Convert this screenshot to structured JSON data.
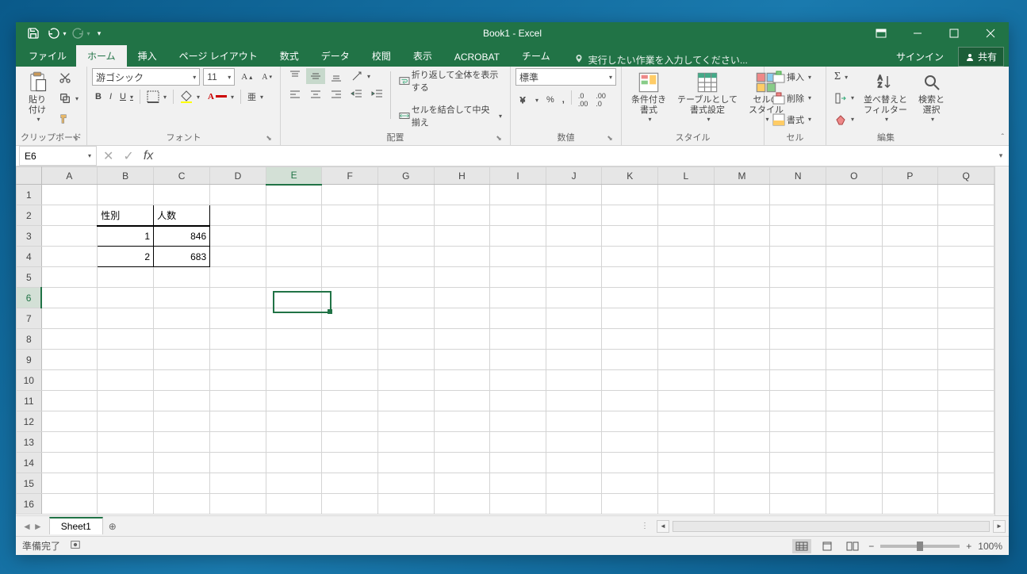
{
  "app": {
    "title": "Book1 - Excel"
  },
  "qat": {
    "save": "保存",
    "undo": "元に戻す",
    "redo": "やり直し"
  },
  "window_controls": {
    "ribbon_display": "リボンの表示オプション",
    "minimize": "最小化",
    "maximize": "最大化",
    "close": "閉じる"
  },
  "tabs": {
    "file": "ファイル",
    "items": [
      "ホーム",
      "挿入",
      "ページ レイアウト",
      "数式",
      "データ",
      "校閲",
      "表示",
      "ACROBAT",
      "チーム"
    ],
    "active_index": 0,
    "tell_me": "実行したい作業を入力してください...",
    "signin": "サインイン",
    "share": "共有"
  },
  "ribbon": {
    "clipboard": {
      "label": "クリップボード",
      "paste": "貼り付け"
    },
    "font": {
      "label": "フォント",
      "name": "游ゴシック",
      "size": "11",
      "bold": "B",
      "italic": "I",
      "underline": "U"
    },
    "alignment": {
      "label": "配置",
      "wrap": "折り返して全体を表示する",
      "merge": "セルを結合して中央揃え"
    },
    "number": {
      "label": "数値",
      "format": "標準"
    },
    "styles": {
      "label": "スタイル",
      "conditional": "条件付き\n書式",
      "table": "テーブルとして\n書式設定",
      "cell": "セルの\nスタイル"
    },
    "cells": {
      "label": "セル",
      "insert": "挿入",
      "delete": "削除",
      "format": "書式"
    },
    "editing": {
      "label": "編集",
      "sort": "並べ替えと\nフィルター",
      "find": "検索と\n選択"
    }
  },
  "formula_bar": {
    "name_box": "E6",
    "formula": ""
  },
  "grid": {
    "columns": [
      "A",
      "B",
      "C",
      "D",
      "E",
      "F",
      "G",
      "H",
      "I",
      "J",
      "K",
      "L",
      "M",
      "N",
      "O",
      "P",
      "Q"
    ],
    "rows": [
      1,
      2,
      3,
      4,
      5,
      6,
      7,
      8,
      9,
      10,
      11,
      12,
      13,
      14,
      15,
      16
    ],
    "selected_col": "E",
    "selected_row": 6,
    "data": {
      "B2": "性別",
      "C2": "人数",
      "B3": "1",
      "C3": "846",
      "B4": "2",
      "C4": "683"
    }
  },
  "sheet_tabs": {
    "active": "Sheet1"
  },
  "statusbar": {
    "ready": "準備完了",
    "zoom": "100%"
  }
}
